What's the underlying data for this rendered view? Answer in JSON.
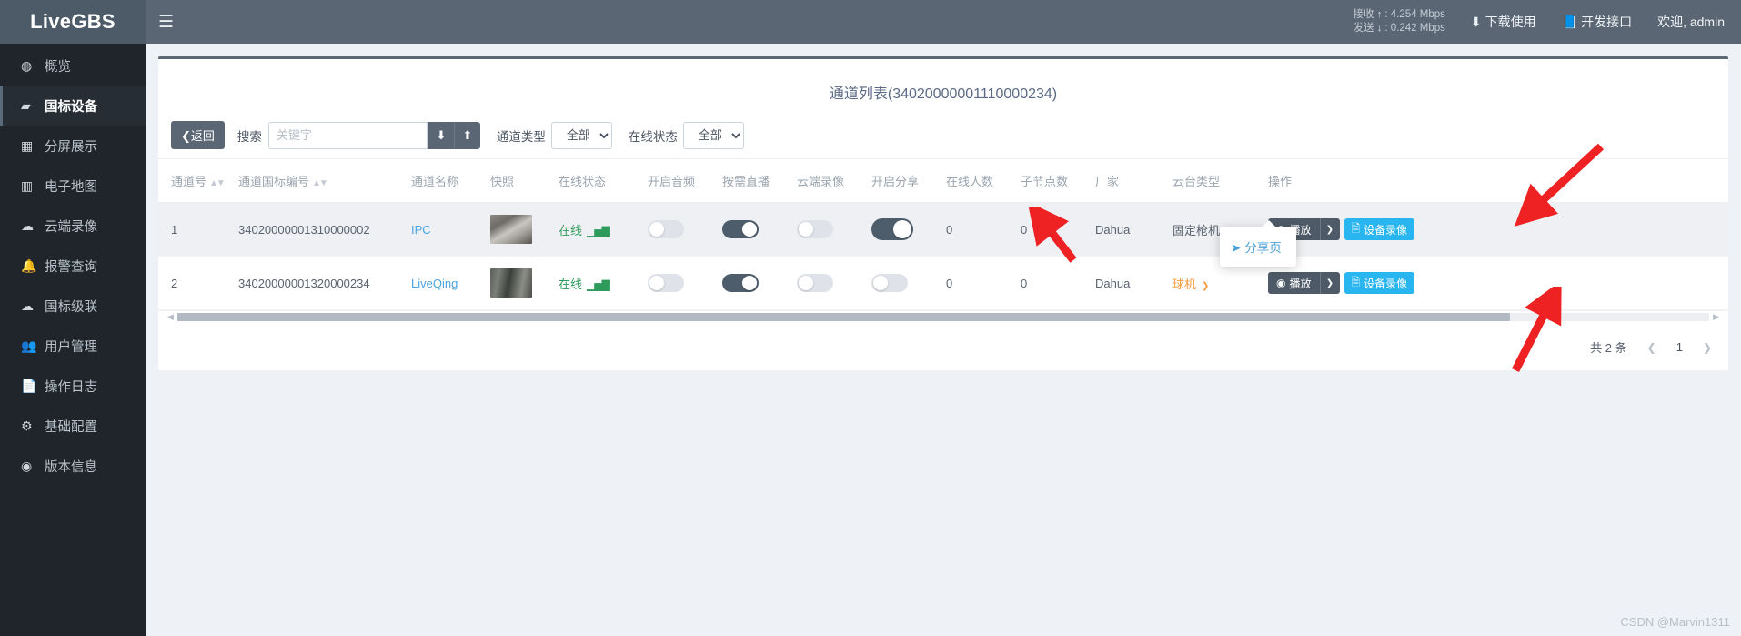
{
  "brand": {
    "name": "LiveGBS"
  },
  "sidebar": {
    "items": [
      {
        "label": "概览",
        "icon": "dashboard-icon",
        "glyph": "◍",
        "active": false
      },
      {
        "label": "国标设备",
        "icon": "video-camera-icon",
        "glyph": "▰",
        "active": true
      },
      {
        "label": "分屏展示",
        "icon": "grid-icon",
        "glyph": "▦",
        "active": false
      },
      {
        "label": "电子地图",
        "icon": "map-icon",
        "glyph": "▥",
        "active": false
      },
      {
        "label": "云端录像",
        "icon": "cloud-icon",
        "glyph": "☁",
        "active": false
      },
      {
        "label": "报警查询",
        "icon": "bell-icon",
        "glyph": "🔔",
        "active": false
      },
      {
        "label": "国标级联",
        "icon": "cloud-upload-icon",
        "glyph": "☁",
        "active": false
      },
      {
        "label": "用户管理",
        "icon": "users-icon",
        "glyph": "👥",
        "active": false
      },
      {
        "label": "操作日志",
        "icon": "file-icon",
        "glyph": "📄",
        "active": false
      },
      {
        "label": "基础配置",
        "icon": "gears-icon",
        "glyph": "⚙",
        "active": false
      },
      {
        "label": "版本信息",
        "icon": "globe-icon",
        "glyph": "◉",
        "active": false
      }
    ]
  },
  "topbar": {
    "menu_icon": "hamburger-icon",
    "recv_label": "接收",
    "recv_arrow": "↑",
    "recv_value": ": 4.254 Mbps",
    "send_label": "发送",
    "send_arrow": "↓",
    "send_value": ": 0.242 Mbps",
    "download_label": "下载使用",
    "download_icon": "download-icon",
    "api_label": "开发接口",
    "api_icon": "book-icon",
    "welcome": "欢迎, admin"
  },
  "page": {
    "title": "通道列表(34020000001110000234)"
  },
  "toolbar": {
    "back_label": "返回",
    "back_icon": "chevron-left-icon",
    "search_label": "搜索",
    "search_value": "",
    "search_placeholder": "关键字",
    "import_icon": "import-icon",
    "export_icon": "export-icon",
    "channel_type_label": "通道类型",
    "channel_type_value": "全部",
    "channel_type_options": [
      "全部"
    ],
    "online_status_label": "在线状态",
    "online_status_value": "全部",
    "online_status_options": [
      "全部"
    ]
  },
  "table": {
    "columns": [
      {
        "label": "通道号",
        "sortable": true
      },
      {
        "label": "通道国标编号",
        "sortable": true
      },
      {
        "label": "通道名称",
        "sortable": false
      },
      {
        "label": "快照",
        "sortable": false
      },
      {
        "label": "在线状态",
        "sortable": false
      },
      {
        "label": "开启音频",
        "sortable": false
      },
      {
        "label": "按需直播",
        "sortable": false
      },
      {
        "label": "云端录像",
        "sortable": false
      },
      {
        "label": "开启分享",
        "sortable": false
      },
      {
        "label": "在线人数",
        "sortable": false
      },
      {
        "label": "子节点数",
        "sortable": false
      },
      {
        "label": "厂家",
        "sortable": false
      },
      {
        "label": "云台类型",
        "sortable": false
      },
      {
        "label": "操作",
        "sortable": false
      }
    ],
    "rows": [
      {
        "channel_no": "1",
        "gb_id": "34020000001310000002",
        "name": "IPC",
        "snapshot": "snapshot-a",
        "status": "在线",
        "status_chart_icon": "bar-chart-icon",
        "audio_on": false,
        "ondemand_on": true,
        "cloud_rec_on": false,
        "share_on": true,
        "share_highlight": true,
        "online_users": "0",
        "child_nodes": "0",
        "vendor": "Dahua",
        "ptz_type": "固定枪机",
        "ptz_orange": false,
        "play_label": "播放",
        "play_icon": "play-circle-icon",
        "caret_icon": "chevron-down-icon",
        "record_label": "设备录像",
        "record_icon": "file-video-icon"
      },
      {
        "channel_no": "2",
        "gb_id": "34020000001320000234",
        "name": "LiveQing",
        "snapshot": "snapshot-b",
        "status": "在线",
        "status_chart_icon": "bar-chart-icon",
        "audio_on": false,
        "ondemand_on": true,
        "cloud_rec_on": false,
        "share_on": false,
        "share_highlight": false,
        "online_users": "0",
        "child_nodes": "0",
        "vendor": "Dahua",
        "ptz_type": "球机",
        "ptz_orange": true,
        "play_label": "播放",
        "play_icon": "play-circle-icon",
        "caret_icon": "chevron-down-icon",
        "record_label": "设备录像",
        "record_icon": "file-video-icon"
      }
    ]
  },
  "dropdown": {
    "items": [
      {
        "label": "分享页",
        "icon": "share-icon"
      }
    ]
  },
  "pagination": {
    "total_text": "共 2 条",
    "prev_icon": "chevron-left-icon",
    "page": "1",
    "next_icon": "chevron-right-icon"
  },
  "watermark": "CSDN @Marvin1311",
  "colors": {
    "sidebar_bg": "#1f252b",
    "topbar_bg": "#5a6673",
    "accent_blue": "#29b6f0",
    "link_blue": "#4ba3e3",
    "online_green": "#2e9b5c",
    "ptz_orange": "#f79a3c",
    "toggle_on": "#4e5d6c",
    "annotation_red": "#ee2222"
  }
}
